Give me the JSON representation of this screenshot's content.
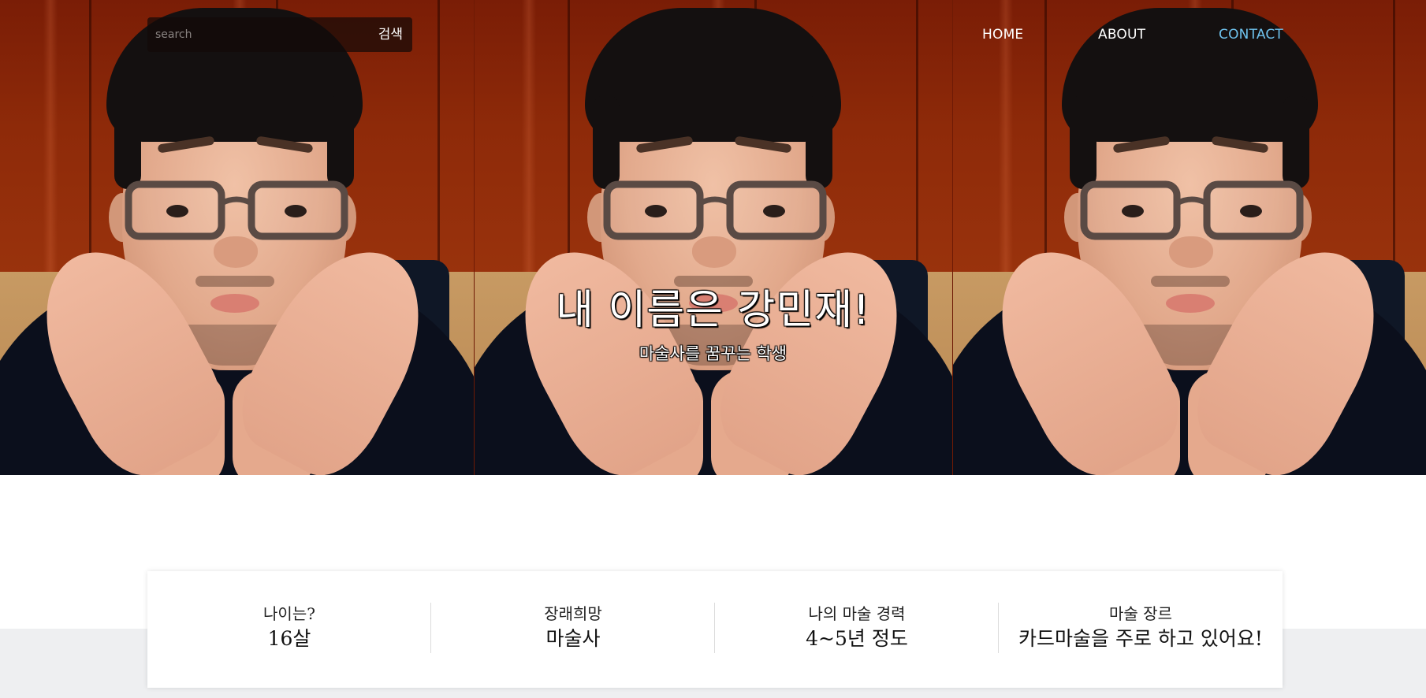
{
  "header": {
    "search": {
      "placeholder": "search",
      "button_label": "검색"
    },
    "nav": {
      "home": "HOME",
      "about": "ABOUT",
      "contact": "CONTACT"
    }
  },
  "hero": {
    "image_description": "three-panel photo of a man with glasses resting his face on his hands",
    "title": "내 이름은 강민재!",
    "subtitle": "마술사를 꿈꾸는 학생"
  },
  "info": {
    "items": [
      {
        "label": "나이는?",
        "value": "16살"
      },
      {
        "label": "장래희망",
        "value": "마술사"
      },
      {
        "label": "나의 마술 경력",
        "value": "4~5년 정도"
      },
      {
        "label": "마술 장르",
        "value": "카드마술을 주로 하고 있어요!"
      }
    ]
  },
  "colors": {
    "active_nav": "#6fc3ee",
    "gray_band": "#eeeff1",
    "search_bg": "#140a08"
  }
}
